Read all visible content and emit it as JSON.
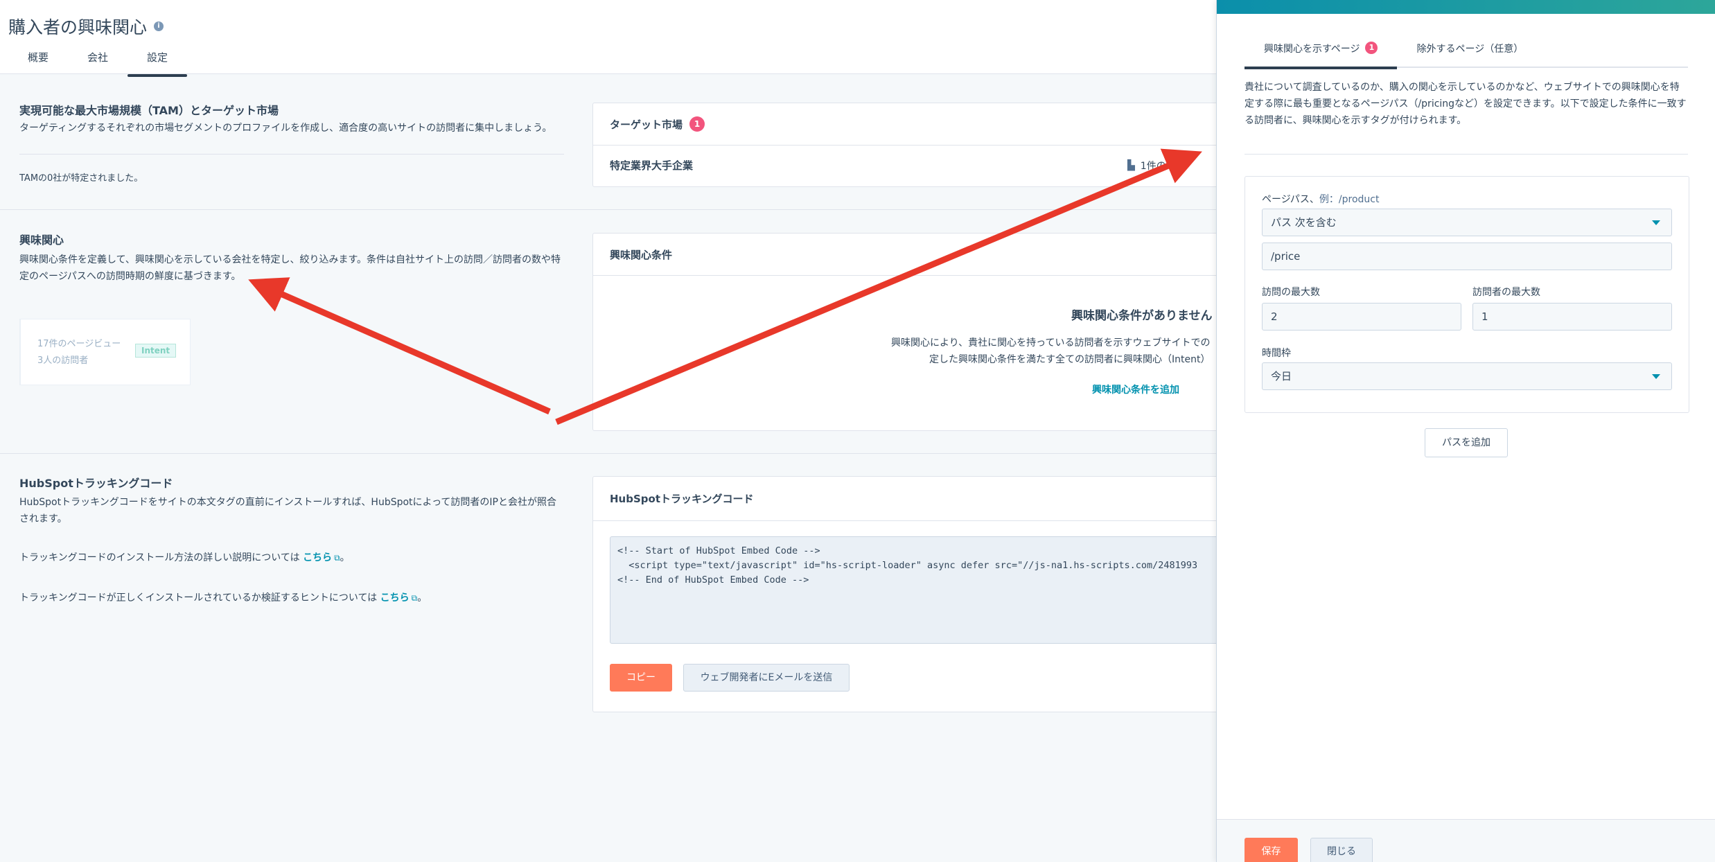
{
  "header": {
    "title": "購入者の興味関心",
    "tabs": [
      {
        "label": "概要"
      },
      {
        "label": "会社"
      },
      {
        "label": "設定"
      }
    ]
  },
  "tam_section": {
    "title": "実現可能な最大市場規模（TAM）とターゲット市場",
    "description": "ターゲティングするそれぞれの市場セグメントのプロファイルを作成し、適合度の高いサイトの訪問者に集中しましょう。",
    "identified": "TAMの0社が特定されました。"
  },
  "target_market_card": {
    "title": "ターゲット市場",
    "badge": "1",
    "row_label": "特定業界大手企業",
    "row_count": "1件の"
  },
  "intent_section": {
    "title": "興味関心",
    "description_line1": "興味関心条件を定義して、興味関心を示している会社を特定し、絞り込みます。条件は自社サイト上の訪問／訪問者の数や特",
    "description_line2": "定のページパスへの訪問時期の鮮度に基づきます。",
    "mini_pageviews": "17件のページビュー",
    "mini_visitors": "3人の訪問者",
    "mini_tag": "Intent"
  },
  "intent_card": {
    "title": "興味関心条件",
    "empty_title": "興味関心条件がありません",
    "empty_line1": "興味関心により、貴社に関心を持っている訪問者を示すウェブサイトでの",
    "empty_line2": "定した興味関心条件を満たす全ての訪問者に興味関心（Intent）",
    "add_link": "興味関心条件を追加"
  },
  "tracking_section": {
    "title": "HubSpotトラッキングコード",
    "description_line1": "HubSpotトラッキングコードをサイトの本文タグの直前にインストールすれば、HubSpotによって訪問者のIPと会社が照合",
    "description_line2": "されます。",
    "install_text": "トラッキングコードのインストール方法の詳しい説明については",
    "verify_text": "トラッキングコードが正しくインストールされているか検証するヒントについては",
    "here_link": "こちら",
    "period": "。"
  },
  "tracking_card": {
    "title": "HubSpotトラッキングコード",
    "code_line1": "<!-- Start of HubSpot Embed Code -->",
    "code_line2": "  <script type=\"text/javascript\" id=\"hs-script-loader\" async defer src=\"//js-na1.hs-scripts.com/2481993",
    "code_line3": "<!-- End of HubSpot Embed Code -->",
    "copy_button": "コピー",
    "email_button": "ウェブ開発者にEメールを送信"
  },
  "panel": {
    "tabs": [
      {
        "label": "興味関心を示すページ",
        "badge": "1"
      },
      {
        "label": "除外するページ（任意）"
      }
    ],
    "description_line1": "貴社について調査しているのか、購入の関心を示しているのかなど、ウェブサイトでの興味関心を特",
    "description_line2": "定する際に最も重要となるページパス（/pricingなど）を設定できます。以下で設定した条件に一致す",
    "description_line3": "る訪問者に、興味関心を示すタグが付けられます。",
    "path_label": "ページパス、",
    "path_example": "例：/product",
    "match_select": "パス 次を含む",
    "path_value": "/price",
    "max_visits_label": "訪問の最大数",
    "max_visits_value": "2",
    "max_visitors_label": "訪問者の最大数",
    "max_visitors_value": "1",
    "timeframe_label": "時間枠",
    "timeframe_value": "今日",
    "add_path_button": "パスを追加",
    "save_button": "保存",
    "close_button": "閉じる"
  },
  "colors": {
    "accent": "#ff7a59",
    "link": "#0091ae",
    "badge": "#f2547d",
    "annotation_arrow": "#e8382a"
  }
}
